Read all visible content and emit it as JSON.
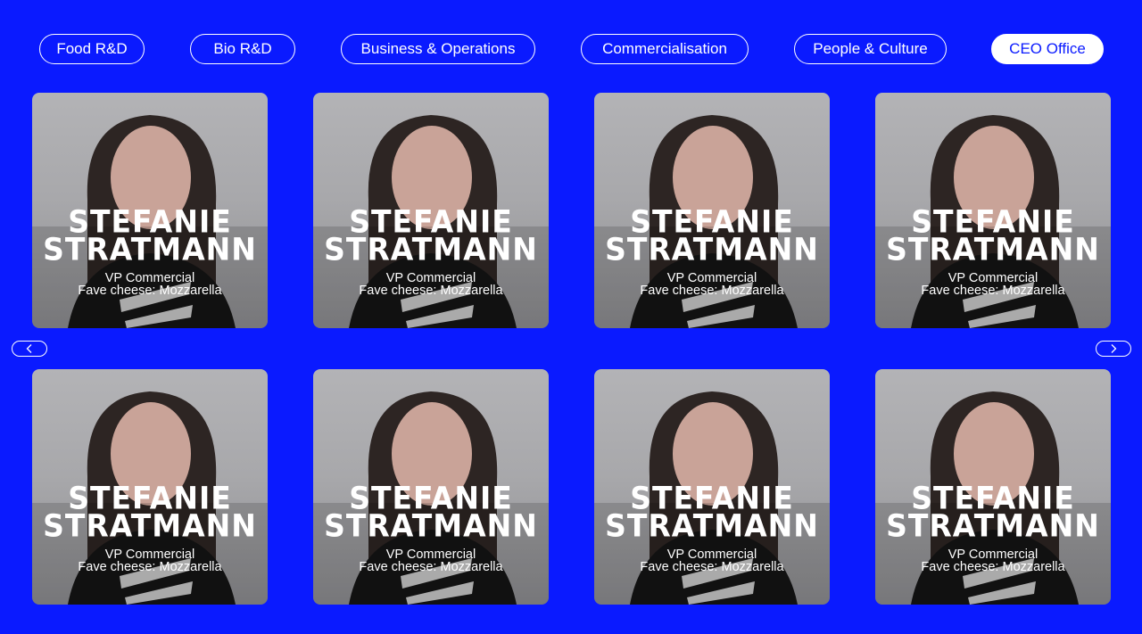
{
  "tabs": [
    {
      "label": "Food R&D",
      "active": false
    },
    {
      "label": "Bio R&D",
      "active": false
    },
    {
      "label": "Business & Operations",
      "active": false
    },
    {
      "label": "Commercialisation",
      "active": false
    },
    {
      "label": "People & Culture",
      "active": false
    },
    {
      "label": "CEO Office",
      "active": true
    }
  ],
  "team": [
    {
      "first_name": "STEFANIE",
      "last_name": "STRATMANN",
      "role": "VP Commercial",
      "fave_cheese": "Fave cheese: Mozzarella"
    },
    {
      "first_name": "STEFANIE",
      "last_name": "STRATMANN",
      "role": "VP Commercial",
      "fave_cheese": "Fave cheese: Mozzarella"
    },
    {
      "first_name": "STEFANIE",
      "last_name": "STRATMANN",
      "role": "VP Commercial",
      "fave_cheese": "Fave cheese: Mozzarella"
    },
    {
      "first_name": "STEFANIE",
      "last_name": "STRATMANN",
      "role": "VP Commercial",
      "fave_cheese": "Fave cheese: Mozzarella"
    },
    {
      "first_name": "STEFANIE",
      "last_name": "STRATMANN",
      "role": "VP Commercial",
      "fave_cheese": "Fave cheese: Mozzarella"
    },
    {
      "first_name": "STEFANIE",
      "last_name": "STRATMANN",
      "role": "VP Commercial",
      "fave_cheese": "Fave cheese: Mozzarella"
    },
    {
      "first_name": "STEFANIE",
      "last_name": "STRATMANN",
      "role": "VP Commercial",
      "fave_cheese": "Fave cheese: Mozzarella"
    },
    {
      "first_name": "STEFANIE",
      "last_name": "STRATMANN",
      "role": "VP Commercial",
      "fave_cheese": "Fave cheese: Mozzarella"
    }
  ],
  "nav": {
    "prev_icon": "chevron-left-icon",
    "next_icon": "chevron-right-icon"
  },
  "colors": {
    "background": "#0a1aff",
    "text": "#ffffff",
    "active_tab_background": "#ffffff",
    "active_tab_text": "#0a1aff"
  }
}
